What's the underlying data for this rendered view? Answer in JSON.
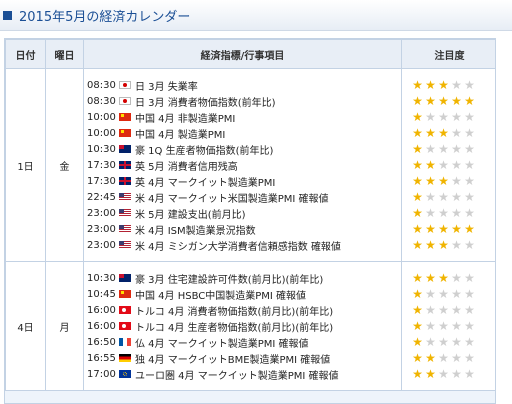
{
  "header": {
    "title": "2015年5月の経済カレンダー"
  },
  "columns": {
    "day": "日付",
    "dow": "曜日",
    "event": "経済指標/行事項目",
    "importance": "注目度"
  },
  "days": [
    {
      "day": "1日",
      "dow": "金",
      "events": [
        {
          "time": "08:30",
          "flag": "jp",
          "text": "日 3月 失業率",
          "stars": 3
        },
        {
          "time": "08:30",
          "flag": "jp",
          "text": "日 3月 消費者物価指数(前年比)",
          "stars": 5
        },
        {
          "time": "10:00",
          "flag": "cn",
          "text": "中国 4月 非製造業PMI",
          "stars": 1
        },
        {
          "time": "10:00",
          "flag": "cn",
          "text": "中国 4月 製造業PMI",
          "stars": 3
        },
        {
          "time": "10:30",
          "flag": "au",
          "text": "豪 1Q 生産者物価指数(前年比)",
          "stars": 1
        },
        {
          "time": "17:30",
          "flag": "gb",
          "text": "英 5月 消費者信用残高",
          "stars": 2
        },
        {
          "time": "17:30",
          "flag": "gb",
          "text": "英 4月 マークイット製造業PMI",
          "stars": 3
        },
        {
          "time": "22:45",
          "flag": "us",
          "text": "米 4月 マークイット米国製造業PMI 確報値",
          "stars": 1
        },
        {
          "time": "23:00",
          "flag": "us",
          "text": "米 5月 建設支出(前月比)",
          "stars": 1
        },
        {
          "time": "23:00",
          "flag": "us",
          "text": "米 4月 ISM製造業景況指数",
          "stars": 5
        },
        {
          "time": "23:00",
          "flag": "us",
          "text": "米 4月 ミシガン大学消費者信頼感指数 確報値",
          "stars": 3
        }
      ]
    },
    {
      "day": "4日",
      "dow": "月",
      "events": [
        {
          "time": "10:30",
          "flag": "au",
          "text": "豪 3月 住宅建設許可件数(前月比)(前年比)",
          "stars": 3
        },
        {
          "time": "10:45",
          "flag": "cn",
          "text": "中国 4月 HSBC中国製造業PMI 確報値",
          "stars": 1
        },
        {
          "time": "16:00",
          "flag": "tr",
          "text": "トルコ 4月 消費者物価指数(前月比)(前年比)",
          "stars": 1
        },
        {
          "time": "16:00",
          "flag": "tr",
          "text": "トルコ 4月 生産者物価指数(前月比)(前年比)",
          "stars": 1
        },
        {
          "time": "16:50",
          "flag": "fr",
          "text": "仏 4月 マークイット製造業PMI 確報値",
          "stars": 1
        },
        {
          "time": "16:55",
          "flag": "de",
          "text": "独 4月 マークイットBME製造業PMI 確報値",
          "stars": 2
        },
        {
          "time": "17:00",
          "flag": "eu",
          "text": "ユーロ圏 4月 マークイット製造業PMI 確報値",
          "stars": 2
        }
      ]
    }
  ]
}
